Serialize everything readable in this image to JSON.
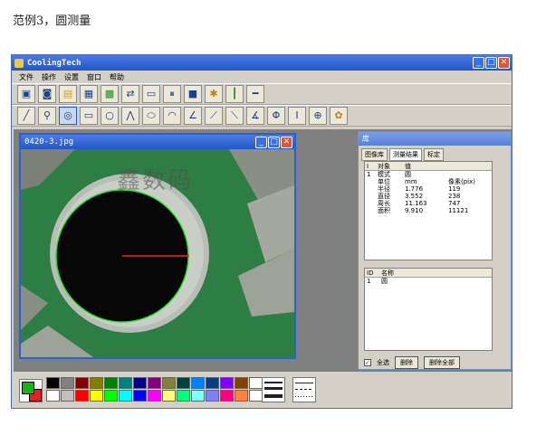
{
  "caption": "范例3，圆测量",
  "app": {
    "title": "CoolingTech",
    "menu": [
      "文件",
      "操作",
      "设置",
      "窗口",
      "帮助"
    ]
  },
  "toolbar1": [
    "monitor-icon",
    "camera-icon",
    "folder-icon",
    "image-icon",
    "capture-icon",
    "transfer-icon",
    "save-icon",
    "pause-icon",
    "stop-icon",
    "wrench-icon",
    "ruler-v-icon",
    "ruler-h-icon"
  ],
  "toolbar2": [
    "line-icon",
    "magnifier-icon",
    "circle-measure-icon",
    "rectangle-icon",
    "circle-icon",
    "polyline-icon",
    "ellipse-icon",
    "arc-icon",
    "angle1-icon",
    "angle2-icon",
    "angle3-icon",
    "angle4-icon",
    "phi-icon",
    "ibeam-icon",
    "phi-arrow-icon",
    "palette-icon"
  ],
  "image_window": {
    "title": "0420-3.jpg",
    "watermark": "鑫数码"
  },
  "library": {
    "title": "库",
    "tabs": [
      "图像库",
      "测量结果",
      "标定"
    ],
    "active_tab": "测量结果",
    "results_headers": [
      "I",
      "对象",
      "值"
    ],
    "results_rows": [
      [
        "1",
        "模式",
        "圆",
        ""
      ],
      [
        "",
        "单位",
        "mm",
        "像素(pix)"
      ],
      [
        "",
        "半径",
        "1.776",
        "119"
      ],
      [
        "",
        "直径",
        "3.552",
        "238"
      ],
      [
        "",
        "周长",
        "11.163",
        "747"
      ],
      [
        "",
        "面积",
        "9.910",
        "11121"
      ]
    ],
    "objects_headers": [
      "ID",
      "名称"
    ],
    "objects_rows": [
      [
        "1",
        "圆"
      ]
    ],
    "select_all": "全选",
    "select_all_checked": true,
    "delete_btn": "删除",
    "delete_all_btn": "删除全部"
  },
  "palette": {
    "current_fg": "#18b318",
    "current_bg": "#e02222",
    "colors_row1": [
      "#000000",
      "#808080",
      "#800000",
      "#808000",
      "#008000",
      "#008080",
      "#000080",
      "#800080",
      "#808040",
      "#004040",
      "#0080ff",
      "#004080",
      "#8000ff",
      "#804000",
      "#ffffff"
    ],
    "colors_row2": [
      "#ffffff",
      "#c0c0c0",
      "#ff0000",
      "#ffff00",
      "#00ff00",
      "#00ffff",
      "#0000ff",
      "#ff00ff",
      "#ffff80",
      "#00ff80",
      "#80ffff",
      "#8080ff",
      "#ff0080",
      "#ff8040",
      "#ffffff"
    ]
  }
}
